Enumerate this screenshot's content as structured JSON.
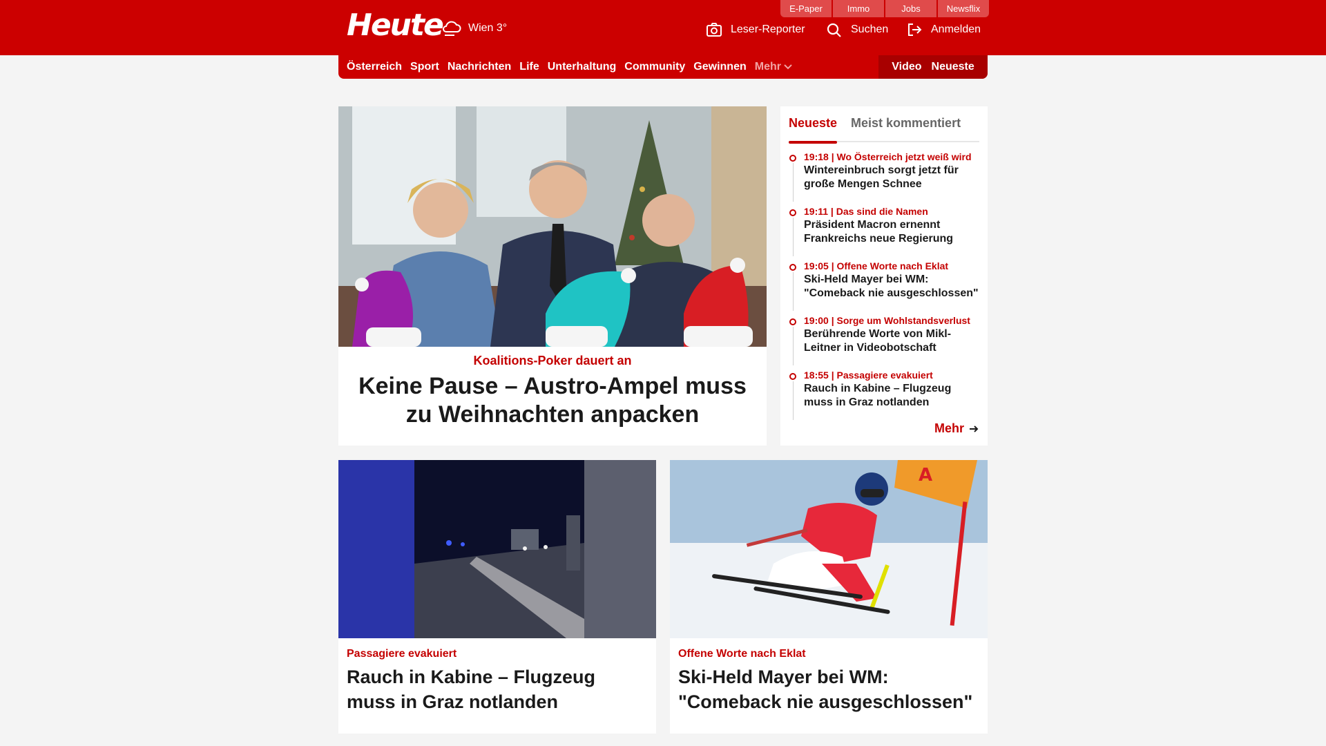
{
  "brand": {
    "logo": "Heute",
    "weather": "Wien 3°",
    "accent": "#cc0000"
  },
  "service_tabs": [
    "E-Paper",
    "Immo",
    "Jobs",
    "Newsflix"
  ],
  "utility": {
    "reporter": "Leser-Reporter",
    "search": "Suchen",
    "login": "Anmelden"
  },
  "nav": {
    "items": [
      "Österreich",
      "Sport",
      "Nachrichten",
      "Life",
      "Unterhaltung",
      "Community",
      "Gewinnen"
    ],
    "more": "Mehr",
    "video": "Video",
    "latest": "Neueste"
  },
  "hero": {
    "kicker": "Koalitions-Poker dauert an",
    "title": "Keine Pause – Austro-Ampel muss zu Weihnachten anpacken"
  },
  "sidebar": {
    "tab_latest": "Neueste",
    "tab_comments": "Meist kommentiert",
    "items": [
      {
        "meta": "19:18 | Wo Österreich jetzt weiß wird",
        "title": "Wintereinbruch sorgt jetzt für große Mengen Schnee"
      },
      {
        "meta": "19:11 | Das sind die Namen",
        "title": "Präsident Macron ernennt Frankreichs neue Regierung"
      },
      {
        "meta": "19:05 | Offene Worte nach Eklat",
        "title": "Ski-Held Mayer bei WM: \"Comeback nie ausgeschlossen\""
      },
      {
        "meta": "19:00 | Sorge um Wohlstandsverlust",
        "title": "Berührende Worte von Mikl-Leitner in Videobotschaft"
      },
      {
        "meta": "18:55 | Passagiere evakuiert",
        "title": "Rauch in Kabine – Flugzeug muss in Graz notlanden"
      }
    ],
    "more": "Mehr"
  },
  "cards": [
    {
      "kicker": "Passagiere evakuiert",
      "title": "Rauch in Kabine – Flugzeug muss in Graz notlanden"
    },
    {
      "kicker": "Offene Worte nach Eklat",
      "title": "Ski-Held Mayer bei WM: \"Comeback nie ausgeschlossen\""
    }
  ],
  "icons": [
    "weather-cloud-icon",
    "camera-icon",
    "search-icon",
    "login-icon",
    "chevron-down-icon",
    "arrow-right-icon"
  ]
}
